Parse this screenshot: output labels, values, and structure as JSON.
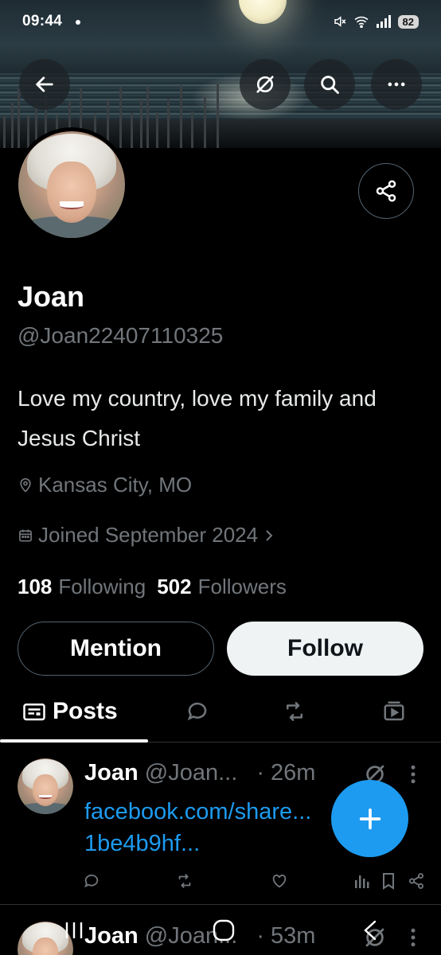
{
  "status_bar": {
    "time": "09:44",
    "battery": "82"
  },
  "header": {
    "back_icon": "arrow-left-icon",
    "grok_icon": "grok-icon",
    "search_icon": "search-icon",
    "more_icon": "more-horizontal-icon"
  },
  "profile": {
    "name": "Joan",
    "handle": "@Joan22407110325",
    "bio": "Love my country, love my family and Jesus Christ",
    "location": "Kansas City, MO",
    "joined": "Joined September 2024",
    "following_count": "108",
    "following_label": "Following",
    "followers_count": "502",
    "followers_label": "Followers"
  },
  "actions": {
    "mention_label": "Mention",
    "follow_label": "Follow"
  },
  "tabs": {
    "posts_label": "Posts"
  },
  "tweets": [
    {
      "name": "Joan",
      "handle": "@Joan...",
      "time": "· 26m",
      "link": "facebook.com/share...",
      "link2": "1be4b9hf..."
    },
    {
      "name": "Joan",
      "handle": "@Joan...",
      "time": "· 53m"
    }
  ],
  "colors": {
    "accent": "#1d9bf0",
    "background": "#000000",
    "muted": "#71767b"
  }
}
